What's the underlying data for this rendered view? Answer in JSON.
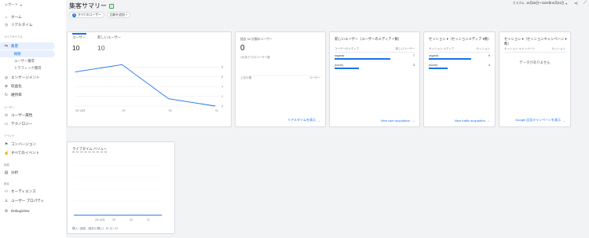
{
  "sidebar": {
    "header": "レポート",
    "items": [
      {
        "label": "ホーム",
        "icon": "home-icon"
      },
      {
        "label": "リアルタイム",
        "icon": "clock-icon"
      },
      {
        "label": "集客",
        "icon": "acquisition-icon"
      },
      {
        "label": "概要"
      },
      {
        "label": "ユーザー獲得"
      },
      {
        "label": "トラフィック獲得"
      },
      {
        "label": "エンゲージメント",
        "icon": "engagement-icon"
      },
      {
        "label": "収益化",
        "icon": "monetization-icon"
      },
      {
        "label": "維持率",
        "icon": "retention-icon"
      },
      {
        "label": "ユーザー属性",
        "icon": "globe-icon"
      },
      {
        "label": "テクノロジー",
        "icon": "devices-icon"
      },
      {
        "label": "コンバージョン",
        "icon": "flag-icon"
      },
      {
        "label": "すべてのイベント",
        "icon": "touch-icon"
      },
      {
        "label": "分析",
        "icon": "analysis-icon"
      },
      {
        "label": "オーディエンス",
        "icon": "audience-icon"
      },
      {
        "label": "ユーザー プロパティ",
        "icon": "user-property-icon"
      },
      {
        "label": "DebugView",
        "icon": "debug-icon"
      }
    ],
    "sections": [
      "ライフサイクル",
      "ユーザー",
      "イベント",
      "探索",
      "設定"
    ]
  },
  "header": {
    "title": "集客サマリー",
    "chip_all_users": "すべてのユーザー",
    "chip_add_compare": "比較を追加 +",
    "date_label": "カスタム",
    "date_value": "10月28日～2020年10月31日"
  },
  "cards": {
    "users": {
      "tab1_label": "ユーザー",
      "tab1_value": "10",
      "tab2_label": "新しいユーザー",
      "tab2_value": "10"
    },
    "realtime": {
      "title": "過去 30 分間のユーザー",
      "value": "0",
      "sub": "1分あたりのユーザー数",
      "col_left": "上位の国",
      "col_right": "ユーザー",
      "link": "リアルタイムを表示"
    },
    "new_users": {
      "title": "新しいユーザー（ユーザーのメディア • 数）",
      "col_left": "ユーザーのメディア",
      "col_right": "新しいユーザー",
      "rows": [
        {
          "label": "organic",
          "value": "7"
        },
        {
          "label": "(none)",
          "value": "3"
        }
      ],
      "link": "View user acquisition"
    },
    "sessions": {
      "title": "セッション ▾（セッションメディア ▾数）",
      "col_left": "セッション メディア",
      "col_right": "セッション",
      "rows": [
        {
          "label": "organic",
          "value": "9"
        },
        {
          "label": "(none)",
          "value": "4"
        }
      ],
      "link": "View traffic acquisition"
    },
    "campaign": {
      "title": "セッション ▾（セッションキャンペーン ▾数）",
      "col_left": "セッション キャンペーン",
      "col_right": "セッション",
      "nodata": "データがありません",
      "link": "Google 広告キャンペーンを表示"
    },
    "lifetime": {
      "title": "ライフタイム バリュー",
      "footer": "購入 / 顧客（最初の購入）30 日 / 20"
    }
  },
  "chart_data": {
    "type": "line",
    "categories": [
      "28 10月",
      "29",
      "30",
      "31"
    ],
    "series": [
      {
        "values": [
          7,
          8.5,
          1.5,
          0
        ]
      }
    ],
    "ylim": [
      0,
      10
    ],
    "yticks": [
      "0",
      "2",
      "4",
      "6",
      "8"
    ],
    "grid": true
  },
  "lifetime_chart": {
    "type": "line",
    "categories": [
      "28 10月",
      "29",
      "30",
      "31"
    ]
  },
  "colors": {
    "accent": "#1a73e8",
    "grid": "#e8eaed"
  }
}
